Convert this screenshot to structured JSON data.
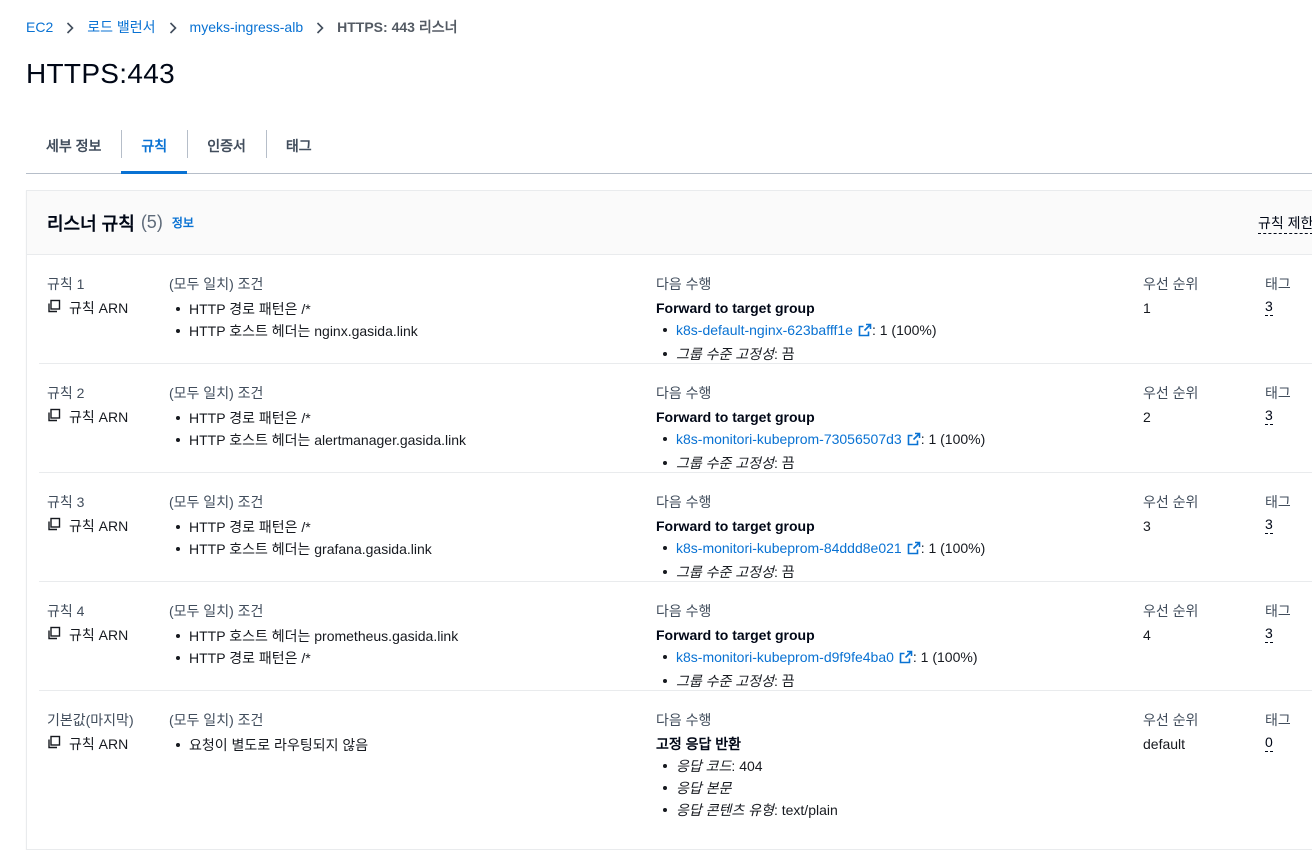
{
  "breadcrumb": [
    "EC2",
    "로드 밸런서",
    "myeks-ingress-alb",
    "HTTPS: 443 리스너"
  ],
  "page_title": "HTTPS:443",
  "tabs": [
    "세부 정보",
    "규칙",
    "인증서",
    "태그"
  ],
  "active_tab": "규칙",
  "panel": {
    "title": "리스너 규칙",
    "count": "(5)",
    "info_link": "정보",
    "limit_link": "규칙 제한"
  },
  "labels": {
    "conditions": "(모두 일치) 조건",
    "action": "다음 수행",
    "priority": "우선 순위",
    "tags": "태그",
    "rule_arn": "규칙 ARN"
  },
  "rules": [
    {
      "name": "규칙 1",
      "conditions": [
        "HTTP 경로 패턴은 /*",
        "HTTP 호스트 헤더는 nginx.gasida.link"
      ],
      "action_title": "Forward to target group",
      "target_group": "k8s-default-nginx-623bafff1e",
      "weight": ": 1 (100%)",
      "stickiness_label": "그룹 수준 고정성",
      "stickiness_value": ": 끔",
      "priority": "1",
      "tags": "3"
    },
    {
      "name": "규칙 2",
      "conditions": [
        "HTTP 경로 패턴은 /*",
        "HTTP 호스트 헤더는 alertmanager.gasida.link"
      ],
      "action_title": "Forward to target group",
      "target_group": "k8s-monitori-kubeprom-73056507d3",
      "weight": ": 1 (100%)",
      "stickiness_label": "그룹 수준 고정성",
      "stickiness_value": ": 끔",
      "priority": "2",
      "tags": "3"
    },
    {
      "name": "규칙 3",
      "conditions": [
        "HTTP 경로 패턴은 /*",
        "HTTP 호스트 헤더는 grafana.gasida.link"
      ],
      "action_title": "Forward to target group",
      "target_group": "k8s-monitori-kubeprom-84ddd8e021",
      "weight": ": 1 (100%)",
      "stickiness_label": "그룹 수준 고정성",
      "stickiness_value": ": 끔",
      "priority": "3",
      "tags": "3"
    },
    {
      "name": "규칙 4",
      "conditions": [
        "HTTP 호스트 헤더는 prometheus.gasida.link",
        "HTTP 경로 패턴은 /*"
      ],
      "action_title": "Forward to target group",
      "target_group": "k8s-monitori-kubeprom-d9f9fe4ba0",
      "weight": ": 1 (100%)",
      "stickiness_label": "그룹 수준 고정성",
      "stickiness_value": ": 끔",
      "priority": "4",
      "tags": "3"
    }
  ],
  "default_rule": {
    "name": "기본값(마지막)",
    "conditions": [
      "요청이 별도로 라우팅되지 않음"
    ],
    "action_title": "고정 응답 반환",
    "response_code_label": "응답 코드",
    "response_code_value": ": 404",
    "response_body_label": "응답 본문",
    "content_type_label": "응답 콘텐츠 유형",
    "content_type_value": ": text/plain",
    "priority": "default",
    "tags": "0"
  },
  "icons": {
    "breadcrumb_separator": "chevron-right-icon",
    "copy": "copy-icon",
    "external_link": "external-link-icon"
  },
  "colors": {
    "link": "#0972d3",
    "text": "#16191f",
    "muted": "#5f6b7a"
  }
}
